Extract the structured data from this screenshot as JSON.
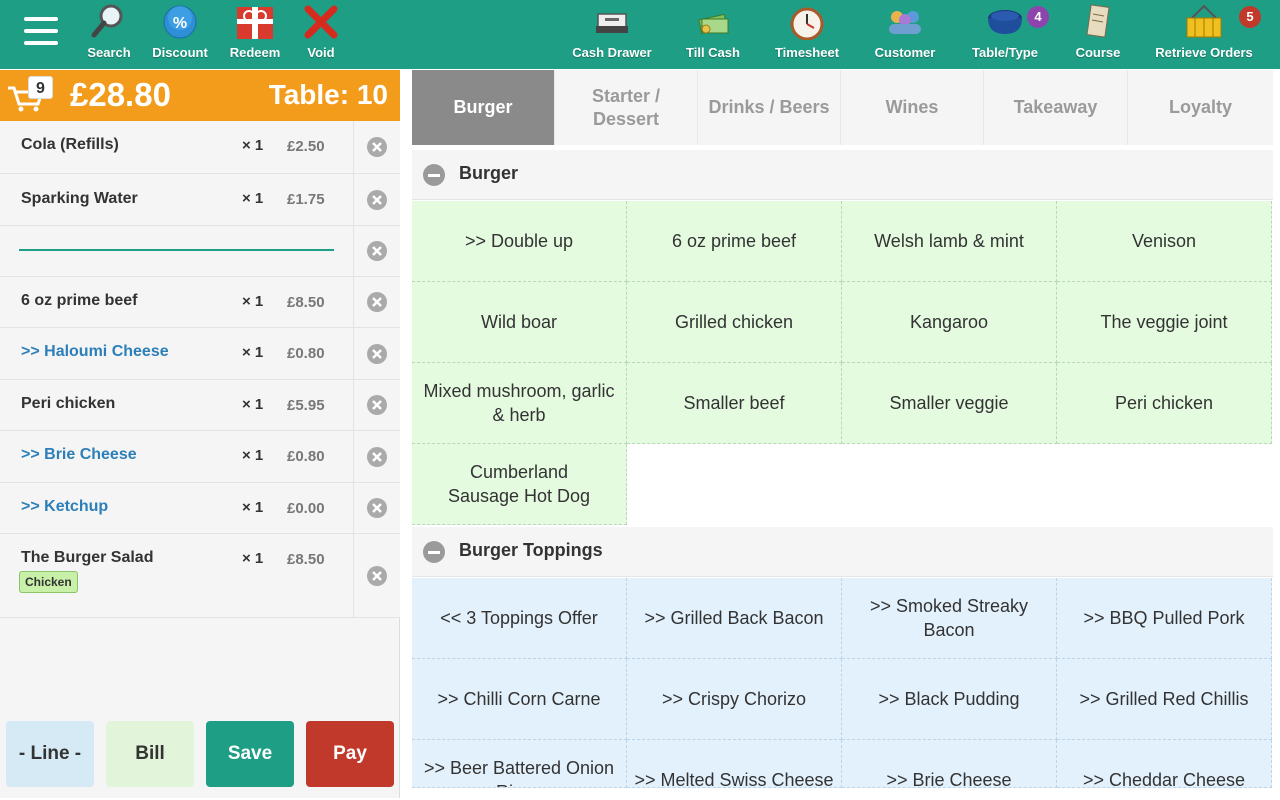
{
  "toolbar": {
    "search_label": "Search",
    "discount_label": "Discount",
    "redeem_label": "Redeem",
    "void_label": "Void",
    "cash_drawer_label": "Cash Drawer",
    "till_cash_label": "Till Cash",
    "timesheet_label": "Timesheet",
    "customer_label": "Customer",
    "table_type_label": "Table/Type",
    "table_type_badge": "4",
    "course_label": "Course",
    "retrieve_orders_label": "Retrieve Orders",
    "retrieve_orders_badge": "5",
    "colors": {
      "bar": "#1f9e86",
      "badge_purple": "#8e44ad",
      "badge_red": "#c0392b"
    }
  },
  "order": {
    "cart_count": "9",
    "total": "£28.80",
    "table": "Table: 10",
    "items": [
      {
        "name": "Cola (Refills)",
        "qty": "× 1",
        "price": "£2.50"
      },
      {
        "name": "Sparking Water",
        "qty": "× 1",
        "price": "£1.75"
      },
      {
        "name": "",
        "qty": "",
        "price": ""
      },
      {
        "name": "6 oz prime beef",
        "qty": "× 1",
        "price": "£8.50"
      },
      {
        "name": ">> Haloumi Cheese",
        "qty": "× 1",
        "price": "£0.80"
      },
      {
        "name": "Peri chicken",
        "qty": "× 1",
        "price": "£5.95"
      },
      {
        "name": ">> Brie Cheese",
        "qty": "× 1",
        "price": "£0.80"
      },
      {
        "name": ">> Ketchup",
        "qty": "× 1",
        "price": "£0.00"
      },
      {
        "name": "The Burger Salad",
        "qty": "× 1",
        "price": "£8.50",
        "tag": "Chicken"
      }
    ]
  },
  "actions": {
    "line": "- Line -",
    "bill": "Bill",
    "save": "Save",
    "pay": "Pay"
  },
  "tabs": [
    "Burger",
    "Starter / Dessert",
    "Drinks / Beers",
    "Wines",
    "Takeaway",
    "Loyalty"
  ],
  "active_tab": "Burger",
  "sections": [
    {
      "title": "Burger",
      "items": [
        ">> Double up",
        "6 oz prime beef",
        "Welsh lamb & mint",
        "Venison",
        "Wild boar",
        "Grilled chicken",
        "Kangaroo",
        "The veggie joint",
        "Mixed mushroom, garlic & herb",
        "Smaller beef",
        "Smaller veggie",
        "Peri chicken",
        "Cumberland Sausage Hot Dog"
      ]
    },
    {
      "title": "Burger Toppings",
      "items": [
        "<< 3 Toppings Offer",
        ">> Grilled Back Bacon",
        ">> Smoked Streaky Bacon",
        ">> BBQ Pulled Pork",
        ">> Chilli Corn Carne",
        ">> Crispy Chorizo",
        ">> Black Pudding",
        ">> Grilled Red Chillis",
        ">> Beer Battered Onion Rings",
        ">> Melted Swiss Cheese",
        ">> Brie Cheese",
        ">> Cheddar Cheese"
      ]
    }
  ]
}
